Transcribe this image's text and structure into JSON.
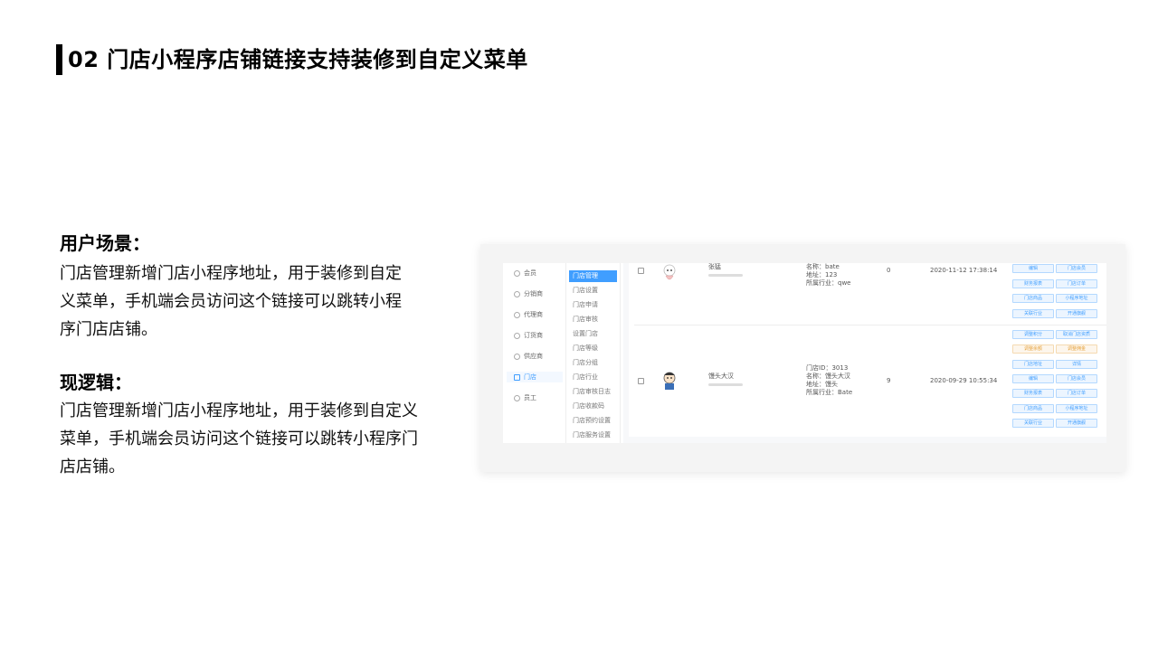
{
  "page": {
    "title": "02 门店小程序店铺链接支持装修到自定义菜单"
  },
  "sections": [
    {
      "heading": "用户场景：",
      "lines": [
        "门店管理新增门店小程序地址，用于装修到自定",
        "义菜单，手机端会员访问这个链接可以跳转小程",
        "序门店店铺。"
      ]
    },
    {
      "heading": "现逻辑：",
      "lines": [
        "门店管理新增门店小程序地址，用于装修到自定义",
        "菜单，手机端会员访问这个链接可以跳转小程序门",
        "店店铺。"
      ]
    }
  ],
  "screenshot": {
    "sidebar": [
      {
        "label": "会员",
        "icon": "user-icon"
      },
      {
        "label": "分销商",
        "icon": "distributor-icon"
      },
      {
        "label": "代理商",
        "icon": "agent-icon"
      },
      {
        "label": "订货商",
        "icon": "order-icon"
      },
      {
        "label": "供应商",
        "icon": "supplier-icon"
      },
      {
        "label": "门店",
        "icon": "store-icon",
        "active": true
      },
      {
        "label": "员工",
        "icon": "staff-icon"
      }
    ],
    "submenu": [
      {
        "label": "门店管理",
        "active": true
      },
      {
        "label": "门店设置"
      },
      {
        "label": "门店申请"
      },
      {
        "label": "门店审核"
      },
      {
        "label": "设置门店"
      },
      {
        "label": "门店等级"
      },
      {
        "label": "门店分组"
      },
      {
        "label": "门店行业"
      },
      {
        "label": "门店审核日志"
      },
      {
        "label": "门店收款码"
      },
      {
        "label": "门店预约设置"
      },
      {
        "label": "门店服务设置"
      }
    ],
    "rows": [
      {
        "name": "张猛",
        "info": [
          "名称：bate",
          "地址：123",
          "所属行业：qwe"
        ],
        "count": "0",
        "time": "2020-11-12 17:38:14",
        "buttons": [
          {
            "label": "编辑",
            "style": "primary"
          },
          {
            "label": "门店会员",
            "style": "primary"
          },
          {
            "label": "财务报表",
            "style": "primary"
          },
          {
            "label": "门店订单",
            "style": "primary"
          },
          {
            "label": "门店商品",
            "style": "primary"
          },
          {
            "label": "小程序地址",
            "style": "primary"
          },
          {
            "label": "关联行业",
            "style": "primary"
          },
          {
            "label": "开通旗舰",
            "style": "primary"
          }
        ]
      },
      {
        "name": "馒头大汉",
        "info": [
          "门店ID：3013",
          "名称：馒头大汉",
          "地址：馒头",
          "所属行业：Bate"
        ],
        "count": "9",
        "time": "2020-09-29 10:55:34",
        "buttons": [
          {
            "label": "调整积分",
            "style": "primary"
          },
          {
            "label": "取消门店资质",
            "style": "primary"
          },
          {
            "label": "调整余额",
            "style": "warning"
          },
          {
            "label": "调整佣金",
            "style": "warning"
          },
          {
            "label": "门店地址",
            "style": "primary"
          },
          {
            "label": "详情",
            "style": "primary"
          },
          {
            "label": "编辑",
            "style": "primary"
          },
          {
            "label": "门店会员",
            "style": "primary"
          },
          {
            "label": "财务报表",
            "style": "primary"
          },
          {
            "label": "门店订单",
            "style": "primary"
          },
          {
            "label": "门店商品",
            "style": "primary"
          },
          {
            "label": "小程序地址",
            "style": "primary"
          },
          {
            "label": "关联行业",
            "style": "primary"
          },
          {
            "label": "开通旗舰",
            "style": "primary"
          }
        ]
      }
    ]
  },
  "colors": {
    "accent": "#409eff",
    "warning": "#e6a23c",
    "title_bar": "#000000"
  }
}
